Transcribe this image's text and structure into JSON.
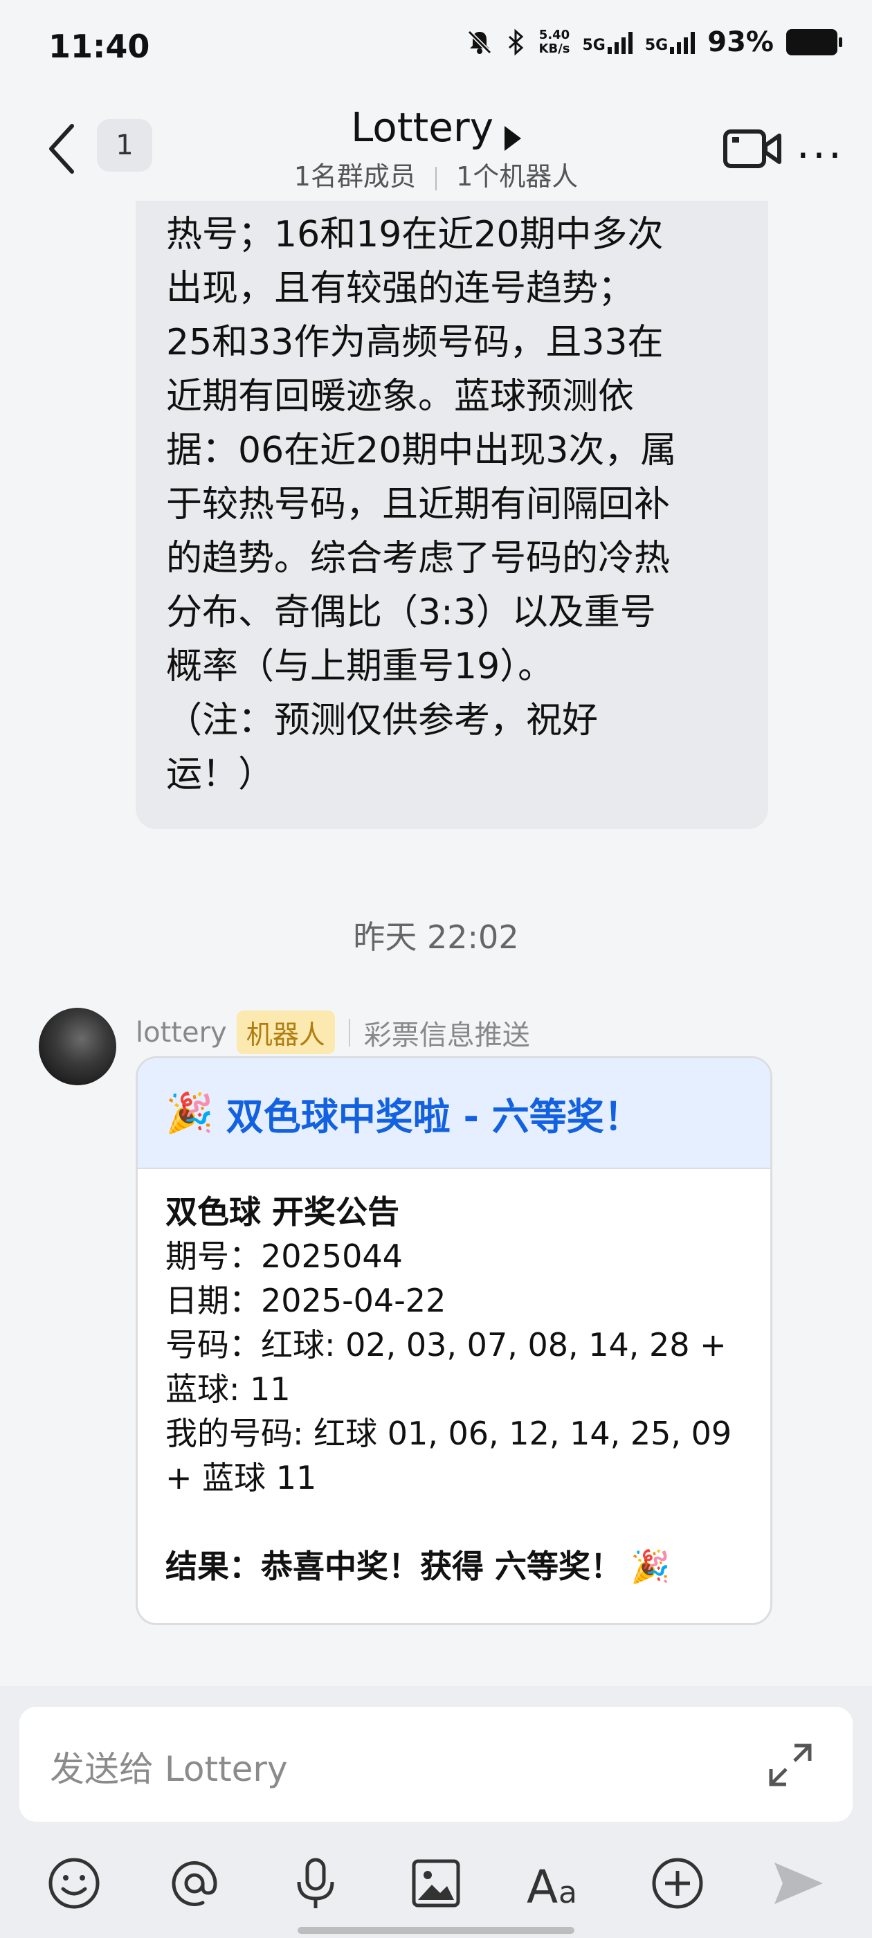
{
  "status_bar": {
    "time": "11:40",
    "speed": "5.40",
    "speed_unit": "KB/s",
    "sim1": "5G",
    "sim2": "5G",
    "battery": "93%"
  },
  "header": {
    "badge_count": "1",
    "title": "Lottery",
    "members": "1名群成员",
    "bots": "1个机器人"
  },
  "messages": {
    "prev_bot_text_lines": [
      "热号；16和19在近20期中多次",
      "出现，且有较强的连号趋势；",
      "25和33作为高频号码，且33在",
      "近期有回暖迹象。蓝球预测依",
      "据：06在近20期中出现3次，属",
      "于较热号码，且近期有间隔回补",
      "的趋势。综合考虑了号码的冷热",
      "分布、奇偶比（3:3）以及重号",
      "概率（与上期重号19）。",
      "（注：预测仅供参考，祝好",
      "运！）"
    ],
    "timestamp": "昨天 22:02",
    "sender_name": "lottery",
    "sender_tag": "机器人",
    "sender_desc": "彩票信息推送",
    "card": {
      "emoji": "🎉",
      "title": "双色球中奖啦 - 六等奖！",
      "line_heading": "双色球 开奖公告",
      "line_issue": "期号：2025044",
      "line_date": "日期：2025-04-22",
      "line_numbers_1": "号码：红球: 02, 03, 07, 08, 14, 28 +",
      "line_numbers_2": "蓝球: 11",
      "line_mine_1": "我的号码: 红球 01, 06, 12, 14, 25, 09",
      "line_mine_2": "+ 蓝球 11",
      "result": "结果：恭喜中奖！获得 六等奖！",
      "result_emoji": "🎉"
    }
  },
  "input": {
    "placeholder": "发送给 Lottery"
  },
  "toolbar": [
    "smile-icon",
    "at-icon",
    "mic-icon",
    "image-icon",
    "text-format-icon",
    "plus-icon",
    "send-icon"
  ]
}
